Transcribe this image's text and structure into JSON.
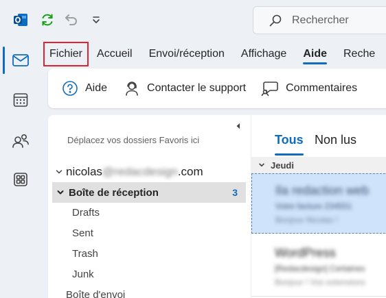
{
  "search": {
    "placeholder": "Rechercher"
  },
  "tabs": [
    {
      "label": "Fichier"
    },
    {
      "label": "Accueil"
    },
    {
      "label": "Envoi/réception"
    },
    {
      "label": "Affichage"
    },
    {
      "label": "Aide"
    },
    {
      "label": "Reche"
    }
  ],
  "ribbon": {
    "help": "Aide",
    "support": "Contacter le support",
    "feedback": "Commentaires"
  },
  "folders": {
    "favorites_hint": "Déplacez vos dossiers Favoris ici",
    "account_prefix": "nicolas",
    "account_blurred": "@redacdesign",
    "account_suffix": ".com",
    "inbox": {
      "label": "Boîte de réception",
      "count": "3"
    },
    "items": [
      {
        "label": "Drafts"
      },
      {
        "label": "Sent"
      },
      {
        "label": "Trash"
      },
      {
        "label": "Junk"
      }
    ],
    "outbox": "Boîte d'envoi"
  },
  "messages": {
    "filter_all": "Tous",
    "filter_unread": "Non lus",
    "group": "Jeudi",
    "list": [
      {
        "sender": "Ila redaction web",
        "subject": "Votre facture 234551",
        "preview": "Bonjour Nicolas !"
      },
      {
        "sender": "WordPress",
        "subject": "[Redacdesign] Certaines",
        "preview": "Bonjour ! Vos extensions"
      }
    ]
  },
  "colors": {
    "accent": "#0f6cbd",
    "highlight_box": "#e0232e",
    "selected_row": "#cfe4fa",
    "sync_green": "#13a10e"
  }
}
